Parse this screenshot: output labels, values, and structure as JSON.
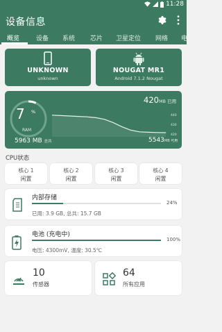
{
  "status_bar": {
    "time": "11:28"
  },
  "app_bar": {
    "title": "设备信息"
  },
  "tabs": [
    "概览",
    "设备",
    "系统",
    "芯片",
    "卫星定位",
    "网络",
    "电"
  ],
  "device_cards": [
    {
      "title": "UNKNOWN",
      "subtitle": "unknown",
      "icon": "phone-icon"
    },
    {
      "title": "NOUGAT MR1",
      "subtitle": "Android 7.1.2 Nougat",
      "icon": "android-icon"
    }
  ],
  "ram": {
    "percent": "7",
    "percent_sign": "%",
    "label": "RAM",
    "used": "420",
    "used_unit": "MB 已用",
    "total": "5963 MB",
    "total_unit": "总共",
    "available": "5543",
    "available_unit": "MB 可用",
    "ticks": [
      "440",
      "430",
      "420"
    ]
  },
  "chart_data": {
    "type": "line",
    "title": "",
    "xlabel": "",
    "ylabel": "",
    "ylim": [
      415,
      450
    ],
    "series": [
      {
        "values": [
          441,
          440.5,
          440,
          439.5,
          439,
          438,
          436,
          432,
          427,
          423,
          421,
          420.5,
          420.2,
          420
        ]
      }
    ]
  },
  "cpu": {
    "title": "CPU状态",
    "cores": [
      {
        "name": "核心 1",
        "state": "闲置"
      },
      {
        "name": "核心 2",
        "state": "闲置"
      },
      {
        "name": "核心 3",
        "state": "闲置"
      },
      {
        "name": "核心 4",
        "state": "闲置"
      }
    ]
  },
  "storage": {
    "title": "内部存储",
    "percent": "24%",
    "fill": 0.24,
    "detail": "已用: 3.9 GB, 总共: 15.7 GB"
  },
  "battery": {
    "title": "电池 (充电中)",
    "percent": "100%",
    "fill": 1.0,
    "detail": "电压: 4300mV, 温度: 30.5℃"
  },
  "sensors": {
    "count": "10",
    "label": "传感器"
  },
  "apps": {
    "count": "64",
    "label": "所有应用"
  },
  "colors": {
    "primary": "#3c7a61",
    "card": "#3d7a62",
    "background": "#f2f2f2"
  }
}
